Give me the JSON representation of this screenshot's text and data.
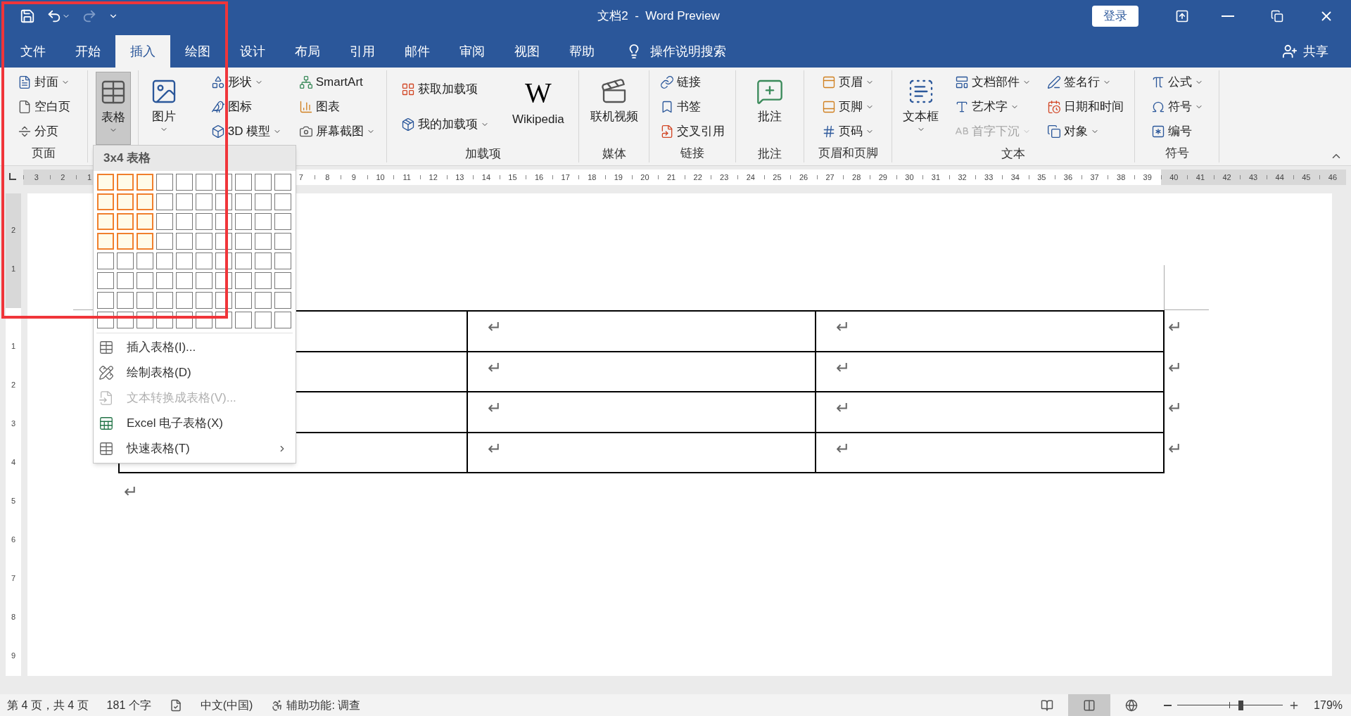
{
  "title_bar": {
    "quick_access": [
      {
        "kind": "save",
        "disabled": false
      },
      {
        "kind": "undo",
        "disabled": false
      },
      {
        "kind": "redo",
        "disabled": true
      },
      {
        "kind": "customize",
        "disabled": false
      }
    ],
    "title": "文档2  -  Word Preview",
    "login": "登录"
  },
  "tabs": [
    {
      "label": "文件",
      "selected": false
    },
    {
      "label": "开始",
      "selected": false
    },
    {
      "label": "插入",
      "selected": true
    },
    {
      "label": "绘图",
      "selected": false
    },
    {
      "label": "设计",
      "selected": false
    },
    {
      "label": "布局",
      "selected": false
    },
    {
      "label": "引用",
      "selected": false
    },
    {
      "label": "邮件",
      "selected": false
    },
    {
      "label": "审阅",
      "selected": false
    },
    {
      "label": "视图",
      "selected": false
    },
    {
      "label": "帮助",
      "selected": false
    }
  ],
  "tell_me": "操作说明搜索",
  "share": "共享",
  "ribbon": {
    "groups": [
      {
        "label": "页面",
        "columns": [
          {
            "kind": "stack",
            "items": [
              {
                "label": "封面",
                "dropdown": true,
                "disabled": false,
                "selected": false
              },
              {
                "label": "空白页",
                "dropdown": false,
                "disabled": false,
                "selected": false
              },
              {
                "label": "分页",
                "dropdown": false,
                "disabled": false,
                "selected": false
              }
            ]
          }
        ]
      },
      {
        "columns": [
          {
            "kind": "large",
            "items": [
              {
                "label": "表格",
                "dropdown": true,
                "disabled": false,
                "selected": true
              }
            ]
          }
        ]
      },
      {
        "columns": [
          {
            "kind": "large",
            "items": [
              {
                "label": "图片",
                "dropdown": true,
                "disabled": false,
                "selected": false
              }
            ]
          },
          {
            "kind": "stack",
            "items": [
              {
                "label": "形状",
                "dropdown": true,
                "disabled": false,
                "selected": false
              },
              {
                "label": "图标",
                "dropdown": false,
                "disabled": false,
                "selected": false
              },
              {
                "label": "3D 模型",
                "dropdown": true,
                "disabled": false,
                "selected": false
              }
            ]
          },
          {
            "kind": "stack",
            "items": [
              {
                "label": "SmartArt",
                "dropdown": false,
                "disabled": false,
                "selected": false
              },
              {
                "label": "图表",
                "dropdown": false,
                "disabled": false,
                "selected": false
              },
              {
                "label": "屏幕截图",
                "dropdown": true,
                "disabled": false,
                "selected": false
              }
            ]
          }
        ]
      },
      {
        "label": "加载项",
        "columns": [
          {
            "kind": "pair",
            "items": [
              {
                "label": "获取加载项",
                "dropdown": false,
                "disabled": false,
                "selected": false
              },
              {
                "label": "我的加载项",
                "dropdown": true,
                "disabled": false,
                "selected": false
              }
            ]
          },
          {
            "kind": "large",
            "items": [
              {
                "label": "Wikipedia",
                "logo": "W",
                "dropdown": false,
                "disabled": false,
                "selected": false
              }
            ]
          }
        ]
      },
      {
        "label": "媒体",
        "columns": [
          {
            "kind": "large",
            "items": [
              {
                "label": "联机视频",
                "dropdown": false,
                "disabled": false,
                "selected": false
              }
            ]
          }
        ]
      },
      {
        "label": "链接",
        "columns": [
          {
            "kind": "stack",
            "items": [
              {
                "label": "链接",
                "dropdown": false,
                "disabled": false,
                "selected": false
              },
              {
                "label": "书签",
                "dropdown": false,
                "disabled": false,
                "selected": false
              },
              {
                "label": "交叉引用",
                "dropdown": false,
                "disabled": false,
                "selected": false
              }
            ]
          }
        ]
      },
      {
        "label": "批注",
        "columns": [
          {
            "kind": "large",
            "items": [
              {
                "label": "批注",
                "dropdown": false,
                "disabled": false,
                "selected": false
              }
            ]
          }
        ]
      },
      {
        "label": "页眉和页脚",
        "columns": [
          {
            "kind": "stack",
            "items": [
              {
                "label": "页眉",
                "dropdown": true,
                "disabled": false,
                "selected": false
              },
              {
                "label": "页脚",
                "dropdown": true,
                "disabled": false,
                "selected": false
              },
              {
                "label": "页码",
                "dropdown": true,
                "disabled": false,
                "selected": false
              }
            ]
          }
        ]
      },
      {
        "label": "文本",
        "columns": [
          {
            "kind": "large",
            "items": [
              {
                "label": "文本框",
                "dropdown": true,
                "disabled": false,
                "selected": false
              }
            ]
          },
          {
            "kind": "stack",
            "items": [
              {
                "label": "文档部件",
                "dropdown": true,
                "disabled": false,
                "selected": false
              },
              {
                "label": "艺术字",
                "dropdown": true,
                "disabled": false,
                "selected": false
              },
              {
                "label": "首字下沉",
                "dropdown": true,
                "disabled": true,
                "selected": false
              }
            ]
          },
          {
            "kind": "stack",
            "items": [
              {
                "label": "签名行",
                "dropdown": true,
                "disabled": false,
                "selected": false
              },
              {
                "label": "日期和时间",
                "dropdown": false,
                "disabled": false,
                "selected": false
              },
              {
                "label": "对象",
                "dropdown": true,
                "disabled": false,
                "selected": false
              }
            ]
          }
        ]
      },
      {
        "label": "符号",
        "columns": [
          {
            "kind": "stack",
            "items": [
              {
                "label": "公式",
                "dropdown": true,
                "disabled": false,
                "selected": false
              },
              {
                "label": "符号",
                "dropdown": true,
                "disabled": false,
                "selected": false
              },
              {
                "label": "编号",
                "dropdown": false,
                "disabled": false,
                "selected": false
              }
            ]
          }
        ]
      }
    ]
  },
  "ruler": {
    "left_numbers": [
      "3",
      "2",
      "1"
    ],
    "numbers": [
      "7",
      "8",
      "9",
      "10",
      "11",
      "12",
      "13",
      "14",
      "15",
      "16",
      "17",
      "18",
      "19",
      "20",
      "21",
      "22",
      "23",
      "24",
      "25",
      "26",
      "27",
      "28",
      "29",
      "30",
      "31",
      "32",
      "33",
      "34",
      "35",
      "36",
      "37",
      "38",
      "39",
      "40",
      "41",
      "42",
      "43",
      "44",
      "45",
      "46"
    ]
  },
  "vertical_ruler": {
    "top_numbers": [
      "2",
      "1"
    ],
    "numbers": [
      "1",
      "2",
      "3",
      "4",
      "5",
      "6",
      "7",
      "8",
      "9"
    ]
  },
  "document": {
    "table": {
      "rows": [
        {
          "cells": [
            "↵",
            "↵"
          ],
          "row_end": "↵"
        },
        {
          "cells": [
            "↵",
            "↵"
          ],
          "row_end": "↵"
        },
        {
          "cells": [
            "↵",
            "↵"
          ],
          "row_end": "↵"
        },
        {
          "cells": [
            "↵",
            "↵"
          ],
          "row_end": "↵"
        }
      ]
    },
    "paragraph_mark": "↵"
  },
  "table_menu": {
    "title": "3x4 表格",
    "grid": [
      {
        "cells": [
          {
            "selected": true
          },
          {
            "selected": true
          },
          {
            "selected": true
          },
          {
            "selected": false
          },
          {
            "selected": false
          },
          {
            "selected": false
          },
          {
            "selected": false
          },
          {
            "selected": false
          },
          {
            "selected": false
          },
          {
            "selected": false
          }
        ]
      },
      {
        "cells": [
          {
            "selected": true
          },
          {
            "selected": true
          },
          {
            "selected": true
          },
          {
            "selected": false
          },
          {
            "selected": false
          },
          {
            "selected": false
          },
          {
            "selected": false
          },
          {
            "selected": false
          },
          {
            "selected": false
          },
          {
            "selected": false
          }
        ]
      },
      {
        "cells": [
          {
            "selected": true
          },
          {
            "selected": true
          },
          {
            "selected": true
          },
          {
            "selected": false
          },
          {
            "selected": false
          },
          {
            "selected": false
          },
          {
            "selected": false
          },
          {
            "selected": false
          },
          {
            "selected": false
          },
          {
            "selected": false
          }
        ]
      },
      {
        "cells": [
          {
            "selected": true
          },
          {
            "selected": true
          },
          {
            "selected": true
          },
          {
            "selected": false
          },
          {
            "selected": false
          },
          {
            "selected": false
          },
          {
            "selected": false
          },
          {
            "selected": false
          },
          {
            "selected": false
          },
          {
            "selected": false
          }
        ]
      },
      {
        "cells": [
          {
            "selected": false
          },
          {
            "selected": false
          },
          {
            "selected": false
          },
          {
            "selected": false
          },
          {
            "selected": false
          },
          {
            "selected": false
          },
          {
            "selected": false
          },
          {
            "selected": false
          },
          {
            "selected": false
          },
          {
            "selected": false
          }
        ]
      },
      {
        "cells": [
          {
            "selected": false
          },
          {
            "selected": false
          },
          {
            "selected": false
          },
          {
            "selected": false
          },
          {
            "selected": false
          },
          {
            "selected": false
          },
          {
            "selected": false
          },
          {
            "selected": false
          },
          {
            "selected": false
          },
          {
            "selected": false
          }
        ]
      },
      {
        "cells": [
          {
            "selected": false
          },
          {
            "selected": false
          },
          {
            "selected": false
          },
          {
            "selected": false
          },
          {
            "selected": false
          },
          {
            "selected": false
          },
          {
            "selected": false
          },
          {
            "selected": false
          },
          {
            "selected": false
          },
          {
            "selected": false
          }
        ]
      },
      {
        "cells": [
          {
            "selected": false
          },
          {
            "selected": false
          },
          {
            "selected": false
          },
          {
            "selected": false
          },
          {
            "selected": false
          },
          {
            "selected": false
          },
          {
            "selected": false
          },
          {
            "selected": false
          },
          {
            "selected": false
          },
          {
            "selected": false
          }
        ]
      }
    ],
    "items": [
      {
        "label": "插入表格(I)...",
        "disabled": false,
        "submenu": false
      },
      {
        "label": "绘制表格(D)",
        "disabled": false,
        "submenu": false
      },
      {
        "label": "文本转换成表格(V)...",
        "disabled": true,
        "submenu": false
      },
      {
        "label": "Excel 电子表格(X)",
        "disabled": false,
        "submenu": false
      },
      {
        "label": "快速表格(T)",
        "disabled": false,
        "submenu": true
      }
    ]
  },
  "status_bar": {
    "page": "第 4 页，共 4 页",
    "words": "181 个字",
    "language": "中文(中国)",
    "accessibility": "辅助功能: 调查",
    "views": [
      {
        "kind": "read",
        "selected": false
      },
      {
        "kind": "print",
        "selected": true
      },
      {
        "kind": "web",
        "selected": false
      }
    ],
    "zoom": {
      "level": 0.6,
      "reading": "179%"
    }
  }
}
